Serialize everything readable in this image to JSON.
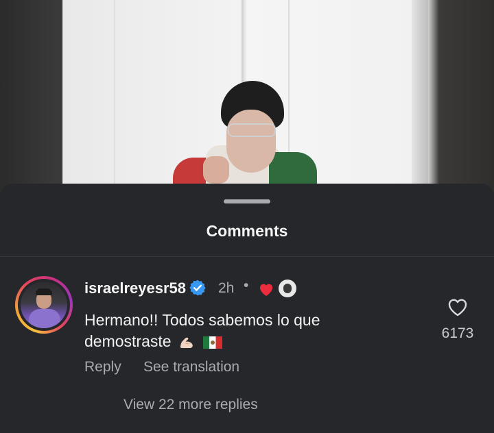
{
  "sheet": {
    "title": "Comments"
  },
  "comment": {
    "username": "israelreyesr58",
    "verified": true,
    "time": "2h",
    "separator": "•",
    "text": "Hermano!! Todos sabemos lo que demostraste",
    "emojis": [
      "flexed-biceps-emoji",
      "mexico-flag-emoji"
    ],
    "like_count": "6173",
    "reply_label": "Reply",
    "translate_label": "See translation",
    "more_replies_label": "View 22 more replies"
  },
  "colors": {
    "background": "#25272b",
    "verified_blue": "#3897f0",
    "heart_red": "#ed2d3d",
    "muted_text": "#a9abb0"
  }
}
